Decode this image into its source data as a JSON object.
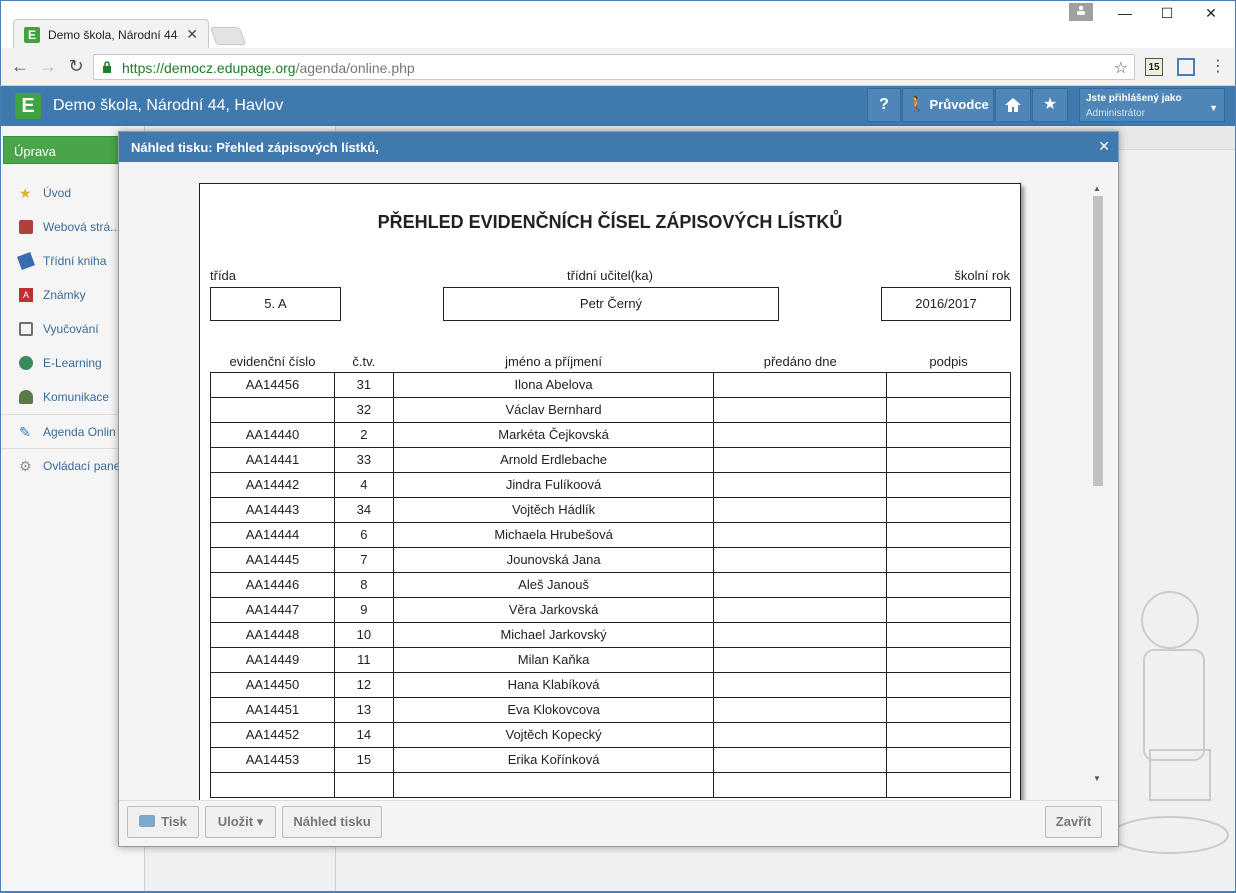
{
  "browser": {
    "tab_title": "Demo škola, Národní 44,",
    "tab_close": "✕",
    "url_host": "https://democz.edupage.org",
    "url_path": "/agenda/online.php",
    "window_minimize": "—",
    "window_maximize": "☐",
    "window_close": "✕",
    "ext_badge": "15"
  },
  "app": {
    "logo": "E",
    "title": "Demo škola, Národní 44, Havlov",
    "help_label": "?",
    "guide_label": "Průvodce",
    "home_icon": "home-icon",
    "star_icon": "star-icon",
    "user_label": "Jste přihlášený jako",
    "user_name": "Administrátor"
  },
  "sidebar": {
    "primary_button": "Úprava",
    "items": [
      {
        "label": "Úvod",
        "icon": "star-icon",
        "color": "#e0b030"
      },
      {
        "label": "Webová strá...",
        "icon": "school-icon",
        "color": "#b04040"
      },
      {
        "label": "Třídní kniha",
        "icon": "book-icon",
        "color": "#3a6ab0"
      },
      {
        "label": "Známky",
        "icon": "grades-icon",
        "color": "#c03030"
      },
      {
        "label": "Vyučování",
        "icon": "teaching-icon",
        "color": "#707070"
      },
      {
        "label": "E-Learning",
        "icon": "globe-icon",
        "color": "#3a8a5a"
      },
      {
        "label": "Komunikace",
        "icon": "people-icon",
        "color": "#5a7a4a"
      },
      {
        "label": "Agenda Onlin",
        "icon": "pen-icon",
        "color": "#3a7ab0"
      },
      {
        "label": "Ovládací pane",
        "icon": "gear-icon",
        "color": "#909090"
      }
    ]
  },
  "modal": {
    "title": "Náhled tisku: Přehled zápisových lístků,",
    "close": "✕",
    "buttons": {
      "print": "Tisk",
      "save": "Uložit ▾",
      "preview": "Náhled tisku",
      "close": "Zavřít"
    }
  },
  "document": {
    "title": "PŘEHLED EVIDENČNÍCH ČÍSEL ZÁPISOVÝCH LÍSTKŮ",
    "class_label": "třída",
    "class_value": "5. A",
    "teacher_label": "třídní učitel(ka)",
    "teacher_value": "Petr Černý",
    "year_label": "školní rok",
    "year_value": "2016/2017",
    "columns": [
      "evidenční číslo",
      "č.tv.",
      "jméno a příjmení",
      "předáno dne",
      "podpis"
    ],
    "rows": [
      [
        "AA14456",
        "31",
        "Ilona Abelova",
        "",
        ""
      ],
      [
        "",
        "32",
        "Václav Bernhard",
        "",
        ""
      ],
      [
        "AA14440",
        "2",
        "Markéta Čejkovská",
        "",
        ""
      ],
      [
        "AA14441",
        "33",
        "Arnold Erdlebache",
        "",
        ""
      ],
      [
        "AA14442",
        "4",
        "Jindra Fulíkoová",
        "",
        ""
      ],
      [
        "AA14443",
        "34",
        "Vojtěch Hádlík",
        "",
        ""
      ],
      [
        "AA14444",
        "6",
        "Michaela Hrubešová",
        "",
        ""
      ],
      [
        "AA14445",
        "7",
        "Jounovská Jana",
        "",
        ""
      ],
      [
        "AA14446",
        "8",
        "Aleš Janouš",
        "",
        ""
      ],
      [
        "AA14447",
        "9",
        "Věra Jarkovská",
        "",
        ""
      ],
      [
        "AA14448",
        "10",
        "Michael Jarkovský",
        "",
        ""
      ],
      [
        "AA14449",
        "11",
        "Milan Kaňka",
        "",
        ""
      ],
      [
        "AA14450",
        "12",
        "Hana Klabíková",
        "",
        ""
      ],
      [
        "AA14451",
        "13",
        "Eva Klokovcova",
        "",
        ""
      ],
      [
        "AA14452",
        "14",
        "Vojtěch Kopecký",
        "",
        ""
      ],
      [
        "AA14453",
        "15",
        "Erika Kořínková",
        "",
        ""
      ],
      [
        "",
        "",
        "",
        "",
        ""
      ]
    ]
  }
}
